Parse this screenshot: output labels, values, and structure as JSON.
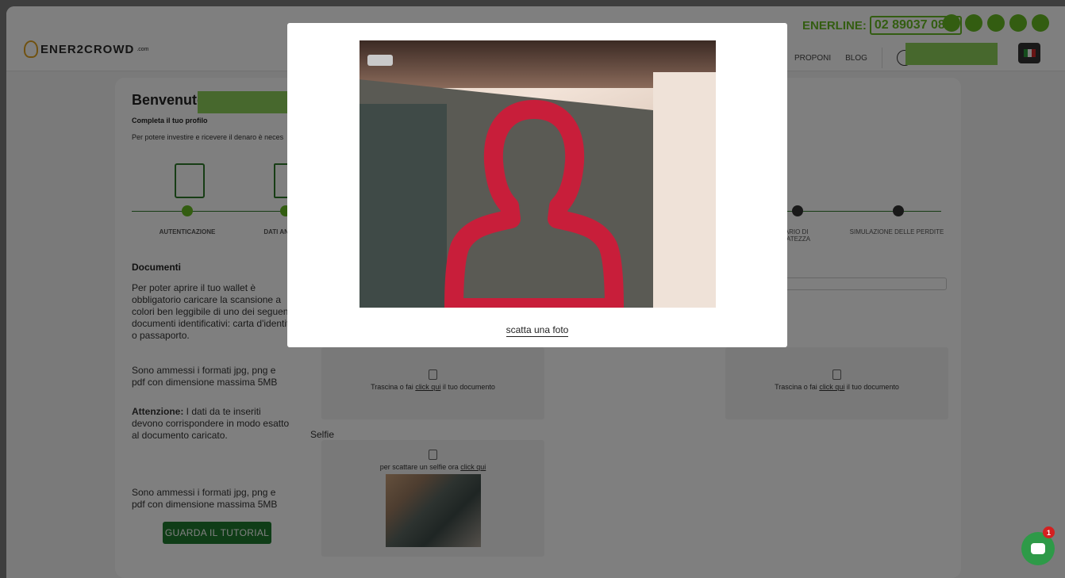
{
  "header": {
    "logo_text": "ENER2CROWD",
    "logo_suffix": ".com",
    "enerline_label": "ENERLINE:",
    "enerline_number": "02 89037 086*",
    "social_icons": [
      "facebook-icon",
      "instagram-icon",
      "linkedin-icon",
      "telegram-icon",
      "youtube-icon"
    ],
    "nav": [
      "PROPONI",
      "BLOG"
    ],
    "brand_color": "#66bb22"
  },
  "page": {
    "welcome": "Benvenuto",
    "complete_profile": "Completa il tuo profilo",
    "intro": "Per potere investire e ricevere il denaro è neces",
    "steps": [
      {
        "label": "AUTENTICAZIONE"
      },
      {
        "label": "DATI ANA"
      },
      {
        "label": "NARIO DI\nRIATEZZA"
      },
      {
        "label": "SIMULAZIONE DELLE PERDITE"
      }
    ],
    "documents_heading": "Documenti",
    "documents_text": "Per poter aprire il tuo wallet è obbligatorio caricare la scansione a colori ben leggibile di uno dei seguenti documenti identificativi: carta d'identità o passaporto.",
    "formats_text": "Sono ammessi i formati jpg, png e pdf con dimensione massima 5MB",
    "attention_label": "Attenzione:",
    "attention_text": " I dati da te inseriti devono corrispondere in modo esatto al documento caricato.",
    "formats_text_2": "Sono ammessi i formati jpg, png e pdf con dimensione massima 5MB",
    "tutorial_button": "GUARDA IL TUTORIAL",
    "drop_prefix": "Trascina o fai ",
    "drop_link": "click qui",
    "drop_suffix": " il tuo documento",
    "selfie_label": "Selfie",
    "selfie_prefix": "per scattare un selfie ora ",
    "selfie_link": "click qui"
  },
  "modal": {
    "snap_label": "scatta una foto",
    "silhouette_color": "#c81e3a"
  },
  "chat": {
    "badge_count": "1"
  }
}
